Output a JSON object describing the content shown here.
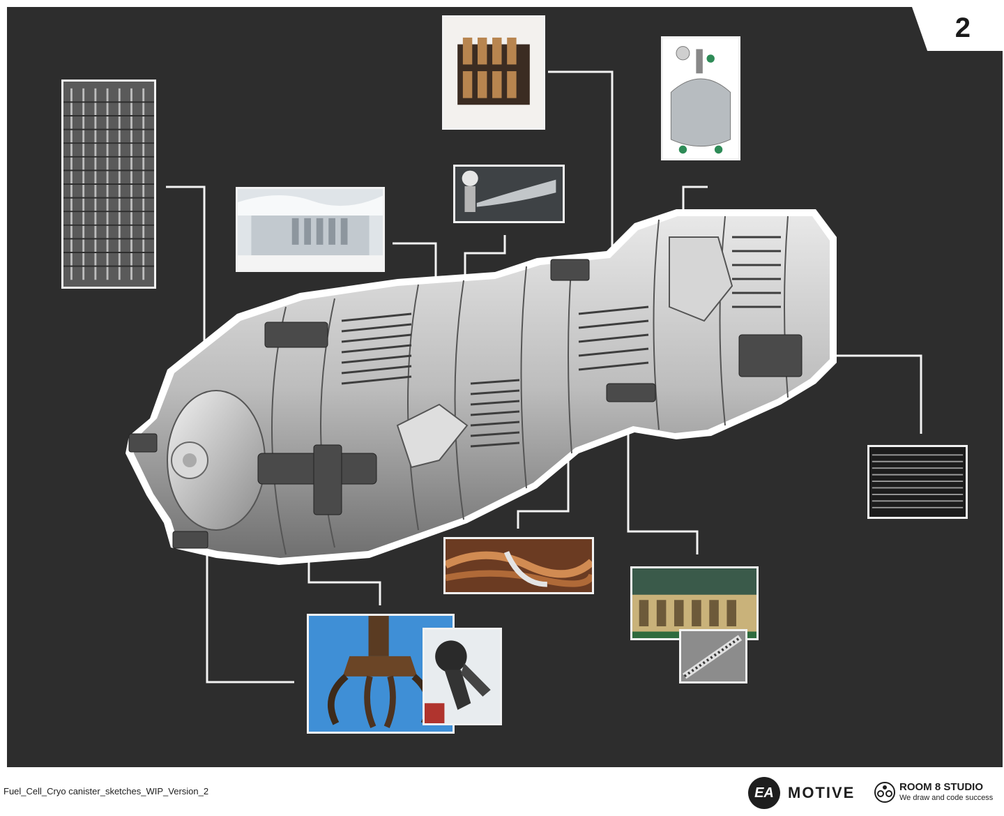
{
  "page_number": "2",
  "footer": {
    "file_label": "Fuel_Cell_Cryo canister_sketches_WIP_Version_2",
    "ea_logo": "EA",
    "motive_logo": "MOTIVE",
    "studio_name": "ROOM 8 STUDIO",
    "studio_tagline": "We draw and code success"
  },
  "colors": {
    "board": "#2d2d2d",
    "callout_line": "#f2f2f2",
    "canister": "#cfcfcf",
    "background": "#ffffff"
  },
  "references": [
    {
      "name": "condenser-coil-photo",
      "subject": "refrigerator condenser coil"
    },
    {
      "name": "freezer-frost-photo",
      "subject": "frosted freezer interior"
    },
    {
      "name": "relay-contactor-photo",
      "subject": "electrical contactor relay"
    },
    {
      "name": "gas-spray-valve-photo",
      "subject": "valve releasing cold gas"
    },
    {
      "name": "dewar-tank-photo",
      "subject": "liquid nitrogen dewar"
    },
    {
      "name": "vent-grille-photo",
      "subject": "horizontal vent grille"
    },
    {
      "name": "copper-pipes-photo",
      "subject": "frosted copper pipes"
    },
    {
      "name": "machine-rig-photo",
      "subject": "industrial machine rig"
    },
    {
      "name": "spring-detail-photo",
      "subject": "mechanical spring detail"
    },
    {
      "name": "scrap-grapple-photo",
      "subject": "scrap metal grapple claw"
    },
    {
      "name": "robot-gripper-photo",
      "subject": "robotic gripper"
    }
  ]
}
